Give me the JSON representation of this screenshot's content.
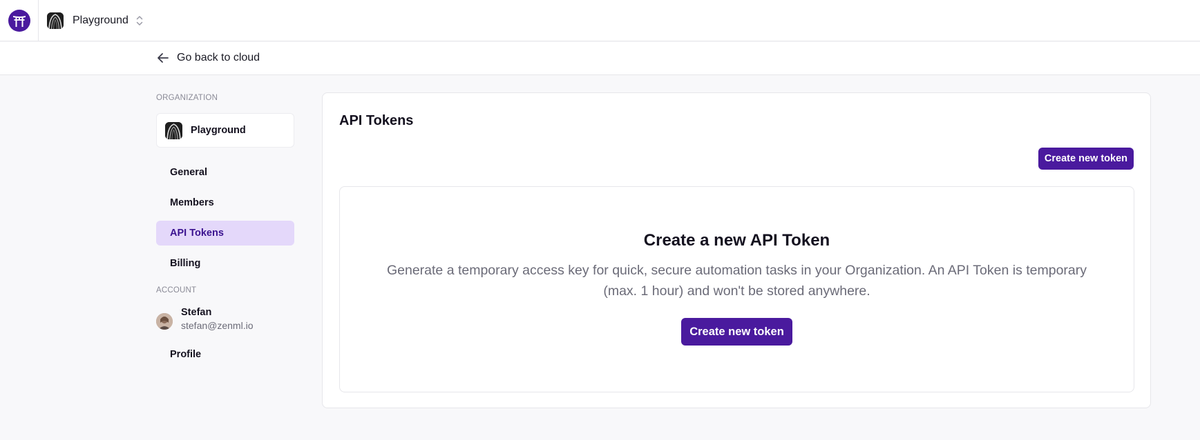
{
  "topbar": {
    "logo_icon": "torii-gate-icon",
    "org_switcher_name": "Playground",
    "switcher_icon": "chevron-up-down-icon"
  },
  "backbar": {
    "label": "Go back to cloud",
    "icon": "arrow-left-icon"
  },
  "sidebar": {
    "organization_label": "ORGANIZATION",
    "org_card_name": "Playground",
    "items": [
      {
        "label": "General",
        "active": false
      },
      {
        "label": "Members",
        "active": false
      },
      {
        "label": "API Tokens",
        "active": true
      },
      {
        "label": "Billing",
        "active": false
      }
    ],
    "account_label": "ACCOUNT",
    "user": {
      "name": "Stefan",
      "email": "stefan@zenml.io"
    },
    "profile_label": "Profile"
  },
  "main": {
    "title": "API Tokens",
    "create_button": "Create new token",
    "empty": {
      "title": "Create a new API Token",
      "description": "Generate a temporary access key for quick, secure automation tasks in your Organization. An API Token is temporary (max. 1 hour) and won't be stored anywhere.",
      "button": "Create new token"
    }
  },
  "colors": {
    "brand": "#4a1a9e",
    "active_nav_bg": "#e4d8fa",
    "active_nav_text": "#3b1390"
  }
}
